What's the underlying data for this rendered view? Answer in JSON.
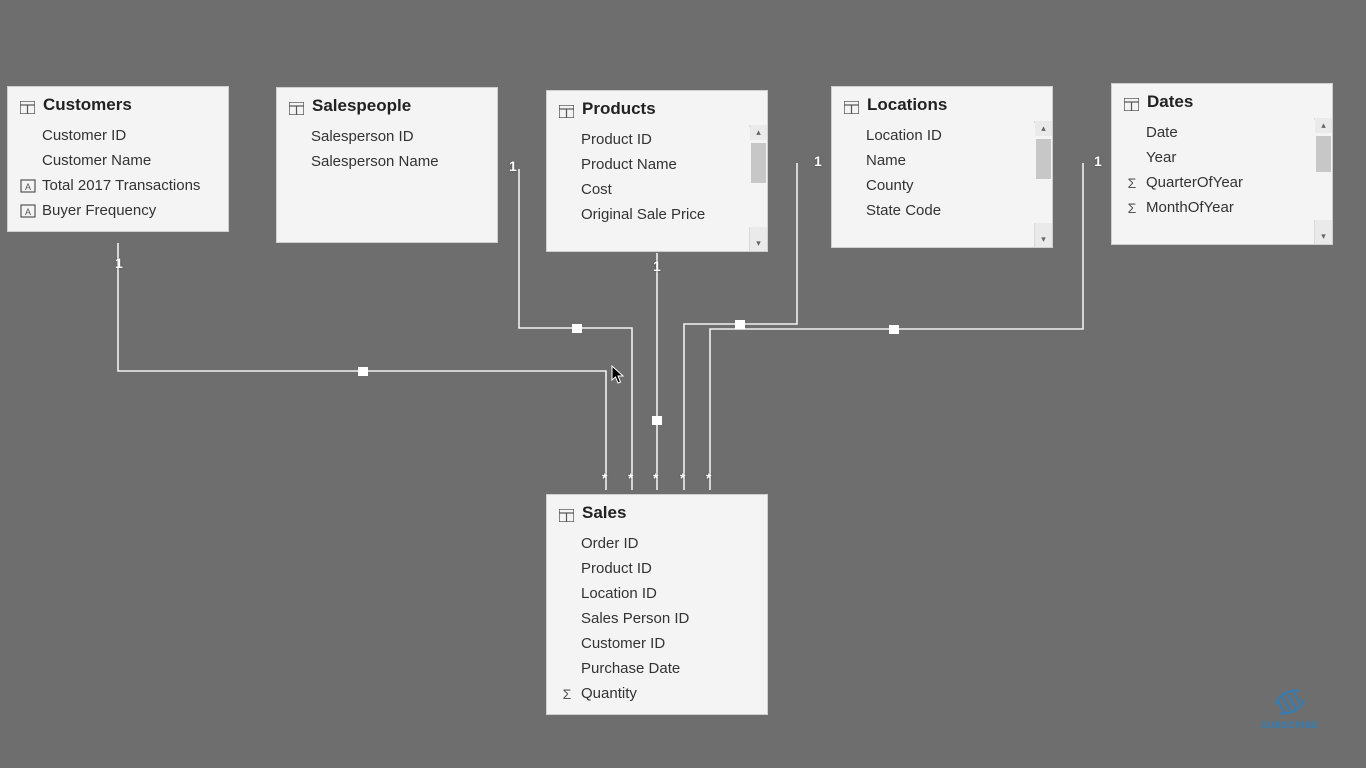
{
  "tables": {
    "customers": {
      "title": "Customers",
      "fields": [
        {
          "label": "Customer ID",
          "icon": null
        },
        {
          "label": "Customer Name",
          "icon": null
        },
        {
          "label": "Total 2017 Transactions",
          "icon": "text-measure"
        },
        {
          "label": "Buyer Frequency",
          "icon": "text-measure"
        }
      ]
    },
    "salespeople": {
      "title": "Salespeople",
      "fields": [
        {
          "label": "Salesperson ID",
          "icon": null
        },
        {
          "label": "Salesperson Name",
          "icon": null
        }
      ]
    },
    "products": {
      "title": "Products",
      "fields": [
        {
          "label": "Product ID",
          "icon": null
        },
        {
          "label": "Product Name",
          "icon": null
        },
        {
          "label": "Cost",
          "icon": null
        },
        {
          "label": "Original Sale Price",
          "icon": null
        }
      ]
    },
    "locations": {
      "title": "Locations",
      "fields": [
        {
          "label": "Location ID",
          "icon": null
        },
        {
          "label": "Name",
          "icon": null
        },
        {
          "label": "County",
          "icon": null
        },
        {
          "label": "State Code",
          "icon": null
        }
      ]
    },
    "dates": {
      "title": "Dates",
      "fields": [
        {
          "label": "Date",
          "icon": null
        },
        {
          "label": "Year",
          "icon": null
        },
        {
          "label": "QuarterOfYear",
          "icon": "sigma"
        },
        {
          "label": "MonthOfYear",
          "icon": "sigma"
        }
      ]
    },
    "sales": {
      "title": "Sales",
      "fields": [
        {
          "label": "Order ID",
          "icon": null
        },
        {
          "label": "Product ID",
          "icon": null
        },
        {
          "label": "Location ID",
          "icon": null
        },
        {
          "label": "Sales Person ID",
          "icon": null
        },
        {
          "label": "Customer ID",
          "icon": null
        },
        {
          "label": "Purchase Date",
          "icon": null
        },
        {
          "label": "Quantity",
          "icon": "sigma"
        }
      ]
    }
  },
  "cardinality": {
    "one": "1",
    "many": "*"
  },
  "badge": {
    "label": "SUBSCRIBE"
  }
}
